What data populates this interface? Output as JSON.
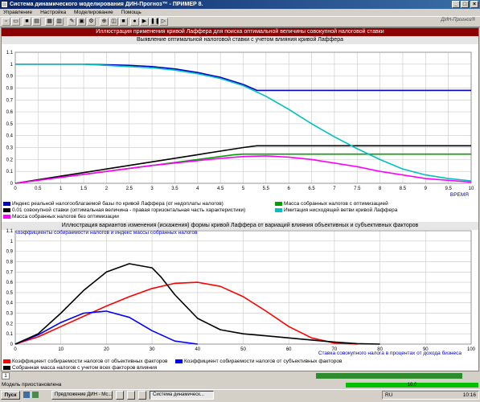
{
  "window": {
    "title": "Система динамического моделирования ДИН-Прогноз™ - ПРИМЕР 8."
  },
  "menu": [
    "Управление",
    "Настройка",
    "Моделирование",
    "Помощь"
  ],
  "toolbar": {
    "brand": "ДИН-Прогноз®"
  },
  "banner": "Иллюстрация применения кривой Лаффера для поиска оптимальной величины совокупной налоговой ставки",
  "chart1_title": "Выявление оптимальной налоговой ставки с учетом влияния кривой Лаффера",
  "chart2_title": "Иллюстрация вариантов изменения (искажения) формы кривой Лаффера от вариаций влияния объективных и субъективных факторов",
  "chart2_subtitle": "Коэффициенты собираемости налогов и индекс массы собранных налогов",
  "legend1": [
    "Индекс реальной налогооблагаемой базы по кривой Лаффера (от недоплаты налогов)",
    "Масса собранных налогов с оптимизацией",
    "0.01 совокупной ставки (оптимальная величина - правая горизонтальная часть характеристики)",
    "Имитация нисходящей ветви кривой Лаффера",
    "Масса собранных налогов без оптимизации"
  ],
  "legend2": [
    "Коэффициент собираемости налогов от объективных факторов",
    "Коэффициент собираемости налогов от субъективных факторов",
    "Собранная масса налогов с учетом всех факторов влияния"
  ],
  "status": {
    "tab": "1",
    "line": "Модель приостановлена",
    "progress": "10.0"
  },
  "taskbar": {
    "start": "Пуск",
    "tasks": [
      "Предложение ДИН - Мс...",
      "Система динамическ..."
    ],
    "lang": "RU",
    "clock": "10:16"
  },
  "chart_data": [
    {
      "type": "line",
      "title": "Выявление оптимальной налоговой ставки с учетом влияния кривой Лаффера",
      "xlabel": "ВРЕМЯ",
      "xlim": [
        0,
        10
      ],
      "ylim": [
        0,
        1.1
      ],
      "xticks": [
        0,
        0.5,
        1,
        1.5,
        2,
        2.5,
        3,
        3.5,
        4,
        4.5,
        5,
        5.5,
        6,
        6.5,
        7,
        7.5,
        8,
        8.5,
        9,
        9.5,
        10
      ],
      "yticks": [
        0,
        0.1,
        0.2,
        0.3,
        0.4,
        0.5,
        0.6,
        0.7,
        0.8,
        0.9,
        1,
        1.1
      ],
      "grid": true,
      "legend": "bottom",
      "series": [
        {
          "name": "Индекс реальной налогооблагаемой базы по кривой Лаффера (от недоплаты налогов)",
          "color": "#0000c0",
          "x": [
            0,
            0.5,
            1,
            1.5,
            2,
            2.5,
            3,
            3.5,
            4,
            4.5,
            5,
            5.3,
            5.5,
            6,
            7,
            8,
            9,
            10
          ],
          "y": [
            1,
            1,
            1,
            1,
            0.995,
            0.99,
            0.98,
            0.96,
            0.93,
            0.89,
            0.83,
            0.78,
            0.78,
            0.78,
            0.78,
            0.78,
            0.78,
            0.78
          ]
        },
        {
          "name": "Масса собранных налогов с оптимизацией",
          "color": "#00a000",
          "x": [
            0,
            1,
            2,
            3,
            4,
            4.8,
            5,
            5.3,
            6,
            7,
            8,
            9,
            10
          ],
          "y": [
            0,
            0.05,
            0.1,
            0.15,
            0.2,
            0.24,
            0.245,
            0.245,
            0.245,
            0.245,
            0.245,
            0.245,
            0.245
          ]
        },
        {
          "name": "0.01 совокупной ставки (оптимальная величина - правая горизонтальная часть характеристики)",
          "color": "#000000",
          "x": [
            0,
            1,
            2,
            3,
            4,
            5,
            5.3,
            6,
            7,
            8,
            9,
            10
          ],
          "y": [
            0,
            0.06,
            0.12,
            0.18,
            0.24,
            0.3,
            0.315,
            0.315,
            0.315,
            0.315,
            0.315,
            0.315
          ]
        },
        {
          "name": "Имитация нисходящей ветви кривой Лаффера",
          "color": "#00c0c0",
          "x": [
            0,
            0.5,
            1,
            1.5,
            2,
            2.5,
            3,
            3.5,
            4,
            4.5,
            5,
            5.5,
            6,
            6.5,
            7,
            7.5,
            8,
            8.5,
            9,
            9.5,
            10
          ],
          "y": [
            1,
            1,
            1,
            1,
            0.99,
            0.98,
            0.97,
            0.95,
            0.92,
            0.88,
            0.82,
            0.73,
            0.62,
            0.5,
            0.39,
            0.29,
            0.2,
            0.12,
            0.07,
            0.04,
            0.02
          ]
        },
        {
          "name": "Масса собранных налогов без оптимизации",
          "color": "#ff00ff",
          "x": [
            0,
            1,
            2,
            3,
            4,
            4.5,
            5,
            5.5,
            6,
            6.5,
            7,
            7.5,
            8,
            8.5,
            9,
            9.5,
            10
          ],
          "y": [
            0,
            0.05,
            0.1,
            0.15,
            0.19,
            0.21,
            0.225,
            0.23,
            0.22,
            0.2,
            0.17,
            0.14,
            0.1,
            0.07,
            0.04,
            0.025,
            0.01
          ]
        }
      ]
    },
    {
      "type": "line",
      "title": "Иллюстрация вариантов изменения (искажения) формы кривой Лаффера от вариаций влияния объективных и субъективных факторов",
      "subtitle": "Коэффициенты собираемости налогов и индекс массы собранных налогов",
      "xlabel": "Ставка совокупного налога в процентах от дохода бизнеса",
      "xlim": [
        0,
        100
      ],
      "ylim": [
        0,
        1.1
      ],
      "xticks": [
        0,
        10,
        20,
        30,
        40,
        50,
        60,
        70,
        80,
        90,
        100
      ],
      "yticks": [
        0,
        0.1,
        0.2,
        0.3,
        0.4,
        0.5,
        0.6,
        0.7,
        0.8,
        0.9,
        1,
        1.1
      ],
      "grid": true,
      "legend": "bottom",
      "series": [
        {
          "name": "Коэффициент собираемости налогов от объективных факторов",
          "color": "#ff0000",
          "x": [
            0,
            5,
            10,
            15,
            20,
            25,
            30,
            35,
            40,
            45,
            50,
            55,
            60,
            65,
            70,
            75
          ],
          "y": [
            0,
            0.07,
            0.17,
            0.27,
            0.37,
            0.46,
            0.54,
            0.59,
            0.6,
            0.56,
            0.46,
            0.32,
            0.17,
            0.06,
            0.01,
            0
          ]
        },
        {
          "name": "Коэффициент собираемости налогов от субъективных факторов",
          "color": "#0000ff",
          "x": [
            0,
            5,
            10,
            15,
            20,
            25,
            30,
            35,
            40
          ],
          "y": [
            0,
            0.09,
            0.21,
            0.3,
            0.32,
            0.26,
            0.13,
            0.03,
            0
          ]
        },
        {
          "name": "Собранная масса налогов с учетом всех факторов влияния",
          "color": "#000000",
          "x": [
            0,
            5,
            10,
            15,
            20,
            25,
            30,
            32,
            35,
            40,
            45,
            50,
            55,
            60,
            65,
            70,
            75,
            80
          ],
          "y": [
            0,
            0.1,
            0.3,
            0.52,
            0.7,
            0.78,
            0.74,
            0.65,
            0.48,
            0.25,
            0.14,
            0.1,
            0.08,
            0.06,
            0.04,
            0.02,
            0.005,
            0
          ]
        }
      ]
    }
  ]
}
